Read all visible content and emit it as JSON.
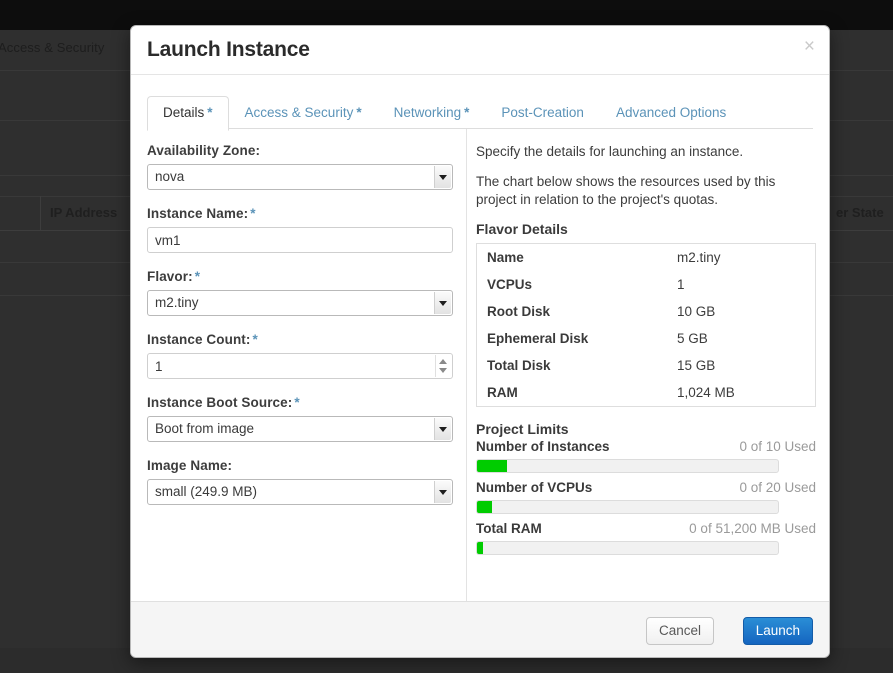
{
  "background": {
    "nav_label": "Access & Security",
    "table_headers": [
      {
        "id": "ip-address",
        "label": "IP Address"
      },
      {
        "id": "power-state",
        "label": "er State"
      }
    ]
  },
  "modal": {
    "title": "Launch Instance",
    "close_icon": "close-icon",
    "close_glyph": "×",
    "tabs": [
      {
        "id": "details",
        "label": "Details",
        "required": true,
        "active": true
      },
      {
        "id": "access-security",
        "label": "Access & Security",
        "required": true,
        "active": false
      },
      {
        "id": "networking",
        "label": "Networking",
        "required": true,
        "active": false
      },
      {
        "id": "post-creation",
        "label": "Post-Creation",
        "required": false,
        "active": false
      },
      {
        "id": "advanced-options",
        "label": "Advanced Options",
        "required": false,
        "active": false
      }
    ],
    "required_marker": "*",
    "form": {
      "availability_zone": {
        "label": "Availability Zone:",
        "required": false,
        "value": "nova"
      },
      "instance_name": {
        "label": "Instance Name:",
        "required": true,
        "value": "vm1",
        "placeholder": ""
      },
      "flavor": {
        "label": "Flavor:",
        "required": true,
        "value": "m2.tiny"
      },
      "instance_count": {
        "label": "Instance Count:",
        "required": true,
        "value": "1",
        "placeholder": ""
      },
      "instance_boot_source": {
        "label": "Instance Boot Source:",
        "required": true,
        "value": "Boot from image"
      },
      "image_name": {
        "label": "Image Name:",
        "required": false,
        "value": "small (249.9 MB)"
      }
    },
    "info": {
      "paragraph_1": "Specify the details for launching an instance.",
      "paragraph_2": "The chart below shows the resources used by this project in relation to the project's quotas.",
      "flavor_details_heading": "Flavor Details",
      "flavor_details": [
        {
          "key": "Name",
          "value": "m2.tiny"
        },
        {
          "key": "VCPUs",
          "value": "1"
        },
        {
          "key": "Root Disk",
          "value": "10 GB"
        },
        {
          "key": "Ephemeral Disk",
          "value": "5 GB"
        },
        {
          "key": "Total Disk",
          "value": "15 GB"
        },
        {
          "key": "RAM",
          "value": "1,024 MB"
        }
      ],
      "project_limits_heading": "Project Limits",
      "limits": [
        {
          "name": "Number of Instances",
          "used": "0 of 10 Used",
          "percent": 10
        },
        {
          "name": "Number of VCPUs",
          "used": "0 of 20 Used",
          "percent": 5
        },
        {
          "name": "Total RAM",
          "used": "0 of 51,200 MB Used",
          "percent": 2
        }
      ],
      "bar_color": "#00cc00"
    },
    "footer": {
      "cancel_label": "Cancel",
      "launch_label": "Launch"
    }
  }
}
